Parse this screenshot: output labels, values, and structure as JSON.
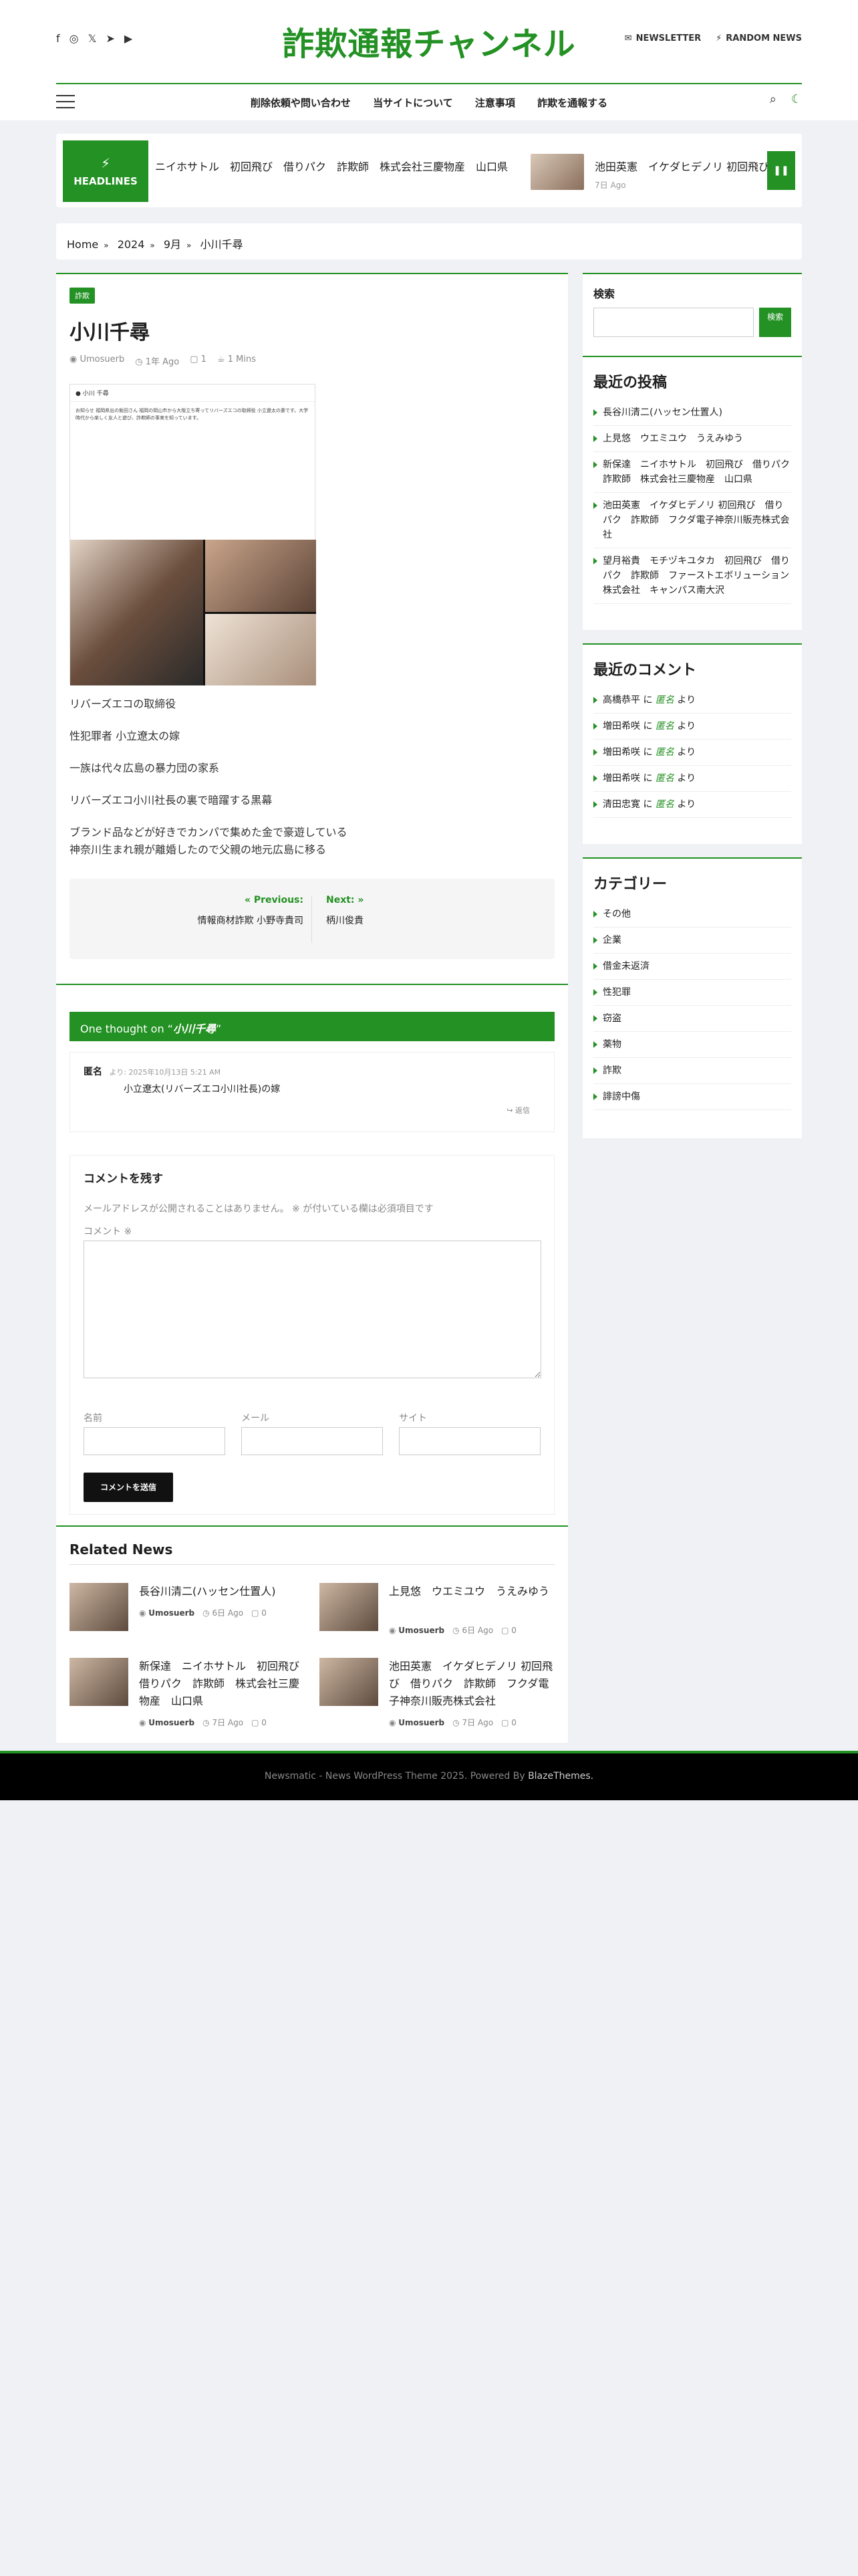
{
  "site": {
    "title": "詐欺通報チャンネル",
    "newsletter": "NEWSLETTER",
    "random": "RANDOM NEWS"
  },
  "social_icons": [
    "facebook-icon",
    "instagram-icon",
    "x-icon",
    "telegram-icon",
    "youtube-icon"
  ],
  "nav": {
    "items": [
      "削除依頼や問い合わせ",
      "当サイトについて",
      "注意事項",
      "詐欺を通報する"
    ]
  },
  "headlines": {
    "label": "HEADLINES",
    "ticker_text": "ニイホサトル　初回飛び　借りパク　詐欺師　株式会社三慶物産　山口県",
    "item2_title": "池田英憲　イケダヒデノリ 初回飛び",
    "item2_date": "7日 Ago"
  },
  "breadcrumb": [
    "Home",
    "2024",
    "9月",
    "小川千尋"
  ],
  "post": {
    "category": "詐欺",
    "title": "小川千尋",
    "author": "Umosuerb",
    "date": "1年 Ago",
    "comments": "1",
    "read": "1 Mins",
    "img_user": "小川 千尋",
    "img_text": "お知らせ 福岡県出の飯田さん 福岡の岡山市から大阪立ち寄ってリバーズエコの取締役 小立遼太の妻です。大学時代から楽しく友人と遊び、詐欺師の事実を知っています。",
    "paragraphs": [
      "リバーズエコの取締役",
      "性犯罪者 小立遼太の嫁",
      "一族は代々広島の暴力団の家系",
      "リバーズエコ小川社長の裏で暗躍する黒幕",
      "ブランド品などが好きでカンパで集めた金で豪遊している\n神奈川生まれ親が離婚したので父親の地元広島に移る"
    ]
  },
  "postnav": {
    "prev_label": "Previous:",
    "prev_title": "情報商材詐欺 小野寺貴司",
    "next_label": "Next:",
    "next_title": "柄川俊貴"
  },
  "comments": {
    "heading_prefix": "One thought on “",
    "heading_title": "小川千尋",
    "heading_suffix": "”",
    "author": "匿名",
    "date": "より: 2025年10月13日 5:21 AM",
    "text": "小立遼太(リバーズエコ小川社長)の嫁",
    "reply": "返信"
  },
  "respond": {
    "title": "コメントを残す",
    "notes": "メールアドレスが公開されることはありません。 ※ が付いている欄は必須項目です",
    "comment_label": "コメント ※",
    "name_label": "名前",
    "email_label": "メール",
    "site_label": "サイト",
    "submit": "コメントを送信"
  },
  "related": {
    "title": "Related News",
    "items": [
      {
        "title": "長谷川清二(ハッセン仕置人)",
        "author": "Umosuerb",
        "date": "6日 Ago",
        "comments": "0"
      },
      {
        "title": "上見悠　ウエミユウ　うえみゆう",
        "author": "Umosuerb",
        "date": "6日 Ago",
        "comments": "0"
      },
      {
        "title": "新保達　ニイホサトル　初回飛び　借りパク　詐欺師　株式会社三慶物産　山口県",
        "author": "Umosuerb",
        "date": "7日 Ago",
        "comments": "0"
      },
      {
        "title": "池田英憲　イケダヒデノリ 初回飛び　借りパク　詐欺師　フクダ電子神奈川販売株式会社",
        "author": "Umosuerb",
        "date": "7日 Ago",
        "comments": "0"
      }
    ]
  },
  "sidebar": {
    "search_label": "検索",
    "search_button": "検索",
    "recent_title": "最近の投稿",
    "recent": [
      "長谷川清二(ハッセン仕置人)",
      "上見悠　ウエミユウ　うえみゆう",
      "新保達　ニイホサトル　初回飛び　借りパク　詐欺師　株式会社三慶物産　山口県",
      "池田英憲　イケダヒデノリ 初回飛び　借りパク　詐欺師　フクダ電子神奈川販売株式会社",
      "望月裕貴　モチヅキユタカ　初回飛び　借りパク　詐欺師　ファーストエボリューション株式会社　キャンパス南大沢"
    ],
    "comments_title": "最近のコメント",
    "recent_comments": [
      {
        "who": "高橋恭平",
        "on": "匿名"
      },
      {
        "who": "増田希咲",
        "on": "匿名"
      },
      {
        "who": "増田希咲",
        "on": "匿名"
      },
      {
        "who": "増田希咲",
        "on": "匿名"
      },
      {
        "who": "清田忠寛",
        "on": "匿名"
      }
    ],
    "comment_joiner": "に",
    "comment_suffix": "より",
    "categories_title": "カテゴリー",
    "categories": [
      "その他",
      "企業",
      "借金未返済",
      "性犯罪",
      "窃盗",
      "薬物",
      "詐欺",
      "誹謗中傷"
    ]
  },
  "footer": {
    "text": "Newsmatic - News WordPress Theme 2025. Powered By ",
    "link": "BlazeThemes."
  },
  "colors": {
    "accent": "#239123",
    "footer": "#000000"
  }
}
